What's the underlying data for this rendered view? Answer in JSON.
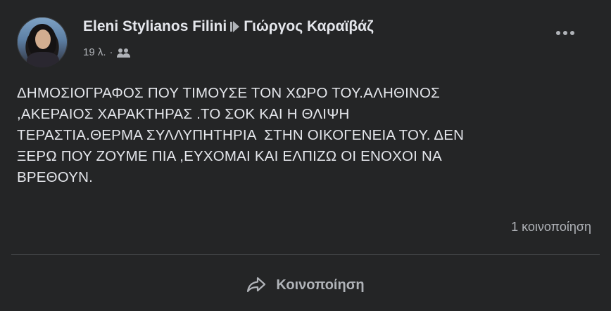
{
  "post": {
    "author": "Eleni Stylianos Filini",
    "recipient": "Γιώργος Καραϊβάζ",
    "time": "19 λ.",
    "separator": "·",
    "text_lines": [
      "ΔΗΜΟΣΙΟΓΡΑΦΟΣ ΠΟΥ ΤΙΜΟΥΣΕ ΤΟΝ ΧΩΡΟ ΤΟΥ.ΑΛΗΘΙΝΟΣ",
      ",ΑΚΕΡΑΙΟΣ ΧΑΡΑΚΤΗΡΑΣ .ΤΟ ΣΟΚ ΚΑΙ Η ΘΛΙΨΗ",
      "ΤΕΡΑΣΤΙΑ.ΘΕΡΜΑ ΣΥΛΛΥΠΗΤΗΡΙΑ  ΣΤΗΝ ΟΙΚΟΓΕΝΕΙΑ ΤΟΥ. ΔΕΝ",
      "ΞΕΡΩ ΠΟΥ ΖΟΥΜΕ ΠΙΑ ,ΕΥΧΟΜΑΙ ΚΑΙ ΕΛΠΙΖΩ ΟΙ ΕΝΟΧΟΙ ΝΑ",
      "ΒΡΕΘΟΥΝ."
    ],
    "share_count": "1 κοινοποίηση"
  },
  "actions": {
    "share_label": "Κοινοποίηση"
  },
  "icons": {
    "audience": "friends-icon",
    "arrow": "triangle-right-icon",
    "more": "more-options-icon",
    "share": "share-arrow-icon"
  },
  "colors": {
    "background": "#242526",
    "primary_text": "#e4e6eb",
    "secondary_text": "#b0b3b8",
    "divider": "#3e4042"
  }
}
